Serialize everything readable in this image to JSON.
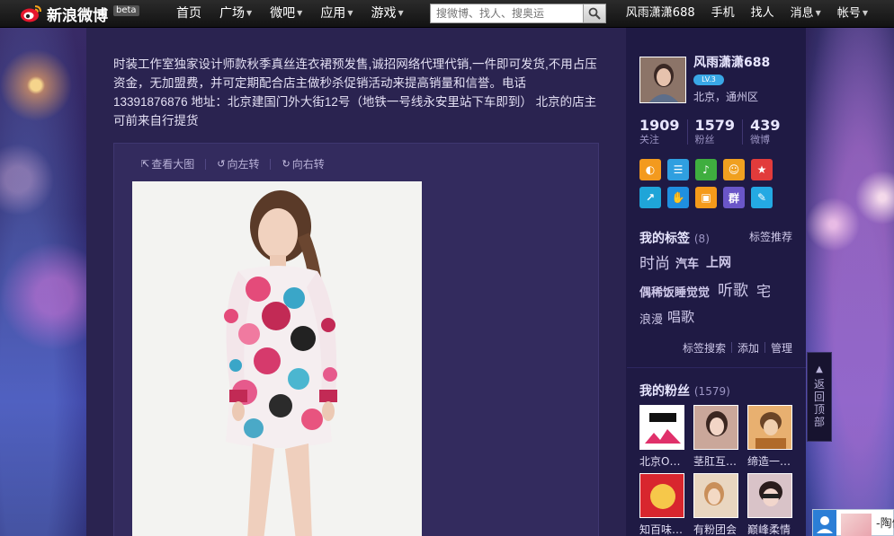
{
  "topbar": {
    "logo": "新浪微博",
    "beta": "beta",
    "nav": [
      {
        "label": "首页",
        "caret": false
      },
      {
        "label": "广场",
        "caret": true
      },
      {
        "label": "微吧",
        "caret": true
      },
      {
        "label": "应用",
        "caret": true
      },
      {
        "label": "游戏",
        "caret": true
      }
    ],
    "search_placeholder": "搜微博、找人、搜奥运",
    "right": [
      {
        "label": "风雨潇潇688",
        "caret": false
      },
      {
        "label": "手机",
        "caret": false
      },
      {
        "label": "找人",
        "caret": false
      },
      {
        "label": "消息",
        "caret": true
      },
      {
        "label": "帐号",
        "caret": true
      }
    ]
  },
  "post": {
    "text": "时装工作室独家设计师款秋季真丝连衣裙预发售,诚招网络代理代销,一件即可发货,不用占压资金，无加盟费，并可定期配合店主做秒杀促销活动来提高销量和信誉。电话13391876876 地址：北京建国门外大街12号（地铁一号线永安里站下车即到） 北京的店主可前来自行提货",
    "actions": [
      "查看大图",
      "向左转",
      "向右转"
    ]
  },
  "sidebar": {
    "username": "风雨潇潇688",
    "level": "LV.3",
    "location": "北京，通州区",
    "counts": [
      {
        "num": "1909",
        "label": "关注"
      },
      {
        "num": "1579",
        "label": "粉丝"
      },
      {
        "num": "439",
        "label": "微博"
      }
    ],
    "apps": [
      {
        "name": "app-1",
        "color": "#f39a1e",
        "glyph": "◐"
      },
      {
        "name": "app-2",
        "color": "#2f9fe0",
        "glyph": "☰"
      },
      {
        "name": "app-3",
        "color": "#3fae3f",
        "glyph": "♪"
      },
      {
        "name": "app-4",
        "color": "#f0a020",
        "glyph": "☺"
      },
      {
        "name": "app-5",
        "color": "#e23b3b",
        "glyph": "★"
      },
      {
        "name": "app-6",
        "color": "#1fa5d8",
        "glyph": "↗"
      },
      {
        "name": "app-7",
        "color": "#1f8fe0",
        "glyph": "✋"
      },
      {
        "name": "app-8",
        "color": "#f59a1a",
        "glyph": "▣"
      },
      {
        "name": "app-9",
        "color": "#6a56c8",
        "glyph": "群"
      },
      {
        "name": "app-10",
        "color": "#24a9e3",
        "glyph": "✎"
      }
    ],
    "tags_title": "我的标签",
    "tags_count": "(8)",
    "tag_recommend": "标签推荐",
    "tags": [
      "时尚",
      "汽车",
      "上网",
      "偶稀饭睡觉觉",
      "听歌",
      "宅",
      "浪漫",
      "唱歌"
    ],
    "tag_links": [
      "标签搜索",
      "添加",
      "管理"
    ],
    "fans_title": "我的粉丝",
    "fans_count": "(1579)",
    "fans": [
      {
        "name": "北京O…"
      },
      {
        "name": "茎肛互…"
      },
      {
        "name": "缔造一…"
      },
      {
        "name": "知百味…"
      },
      {
        "name": "有粉团会"
      },
      {
        "name": "巅峰柔情"
      }
    ]
  },
  "back_to_top": "返回顶部",
  "popup_text": "-陶傲"
}
